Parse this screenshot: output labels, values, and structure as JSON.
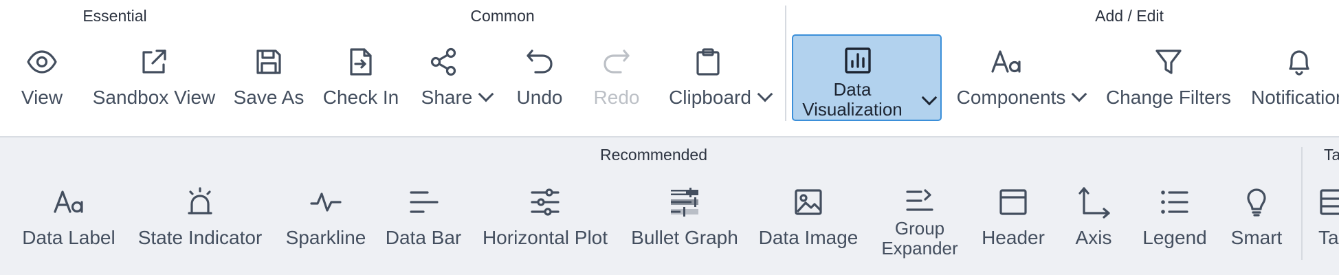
{
  "toolbar": {
    "groups": {
      "essential": "Essential",
      "common": "Common",
      "add_edit": "Add / Edit"
    },
    "buttons": {
      "view": "View",
      "sandbox_view": "Sandbox View",
      "save_as": "Save As",
      "check_in": "Check In",
      "share": "Share",
      "undo": "Undo",
      "redo": "Redo",
      "clipboard": "Clipboard",
      "data_visualization": "Data Visualization",
      "components": "Components",
      "change_filters": "Change Filters",
      "notifications": "Notifications"
    }
  },
  "recommended": {
    "title": "Recommended",
    "next_group_title": "Ta",
    "items": {
      "data_label": "Data Label",
      "state_indicator": "State Indicator",
      "sparkline": "Sparkline",
      "data_bar": "Data Bar",
      "horizontal_plot": "Horizontal Plot",
      "bullet_graph": "Bullet Graph",
      "data_image": "Data Image",
      "group_expander": "Group Expander",
      "header": "Header",
      "axis": "Axis",
      "legend": "Legend",
      "smart": "Smart",
      "next_item": "Ta"
    }
  },
  "colors": {
    "active_bg": "#b2d2ee",
    "active_border": "#3b8fd9",
    "icon": "#434e5e",
    "subbar_bg": "#eef0f4"
  }
}
